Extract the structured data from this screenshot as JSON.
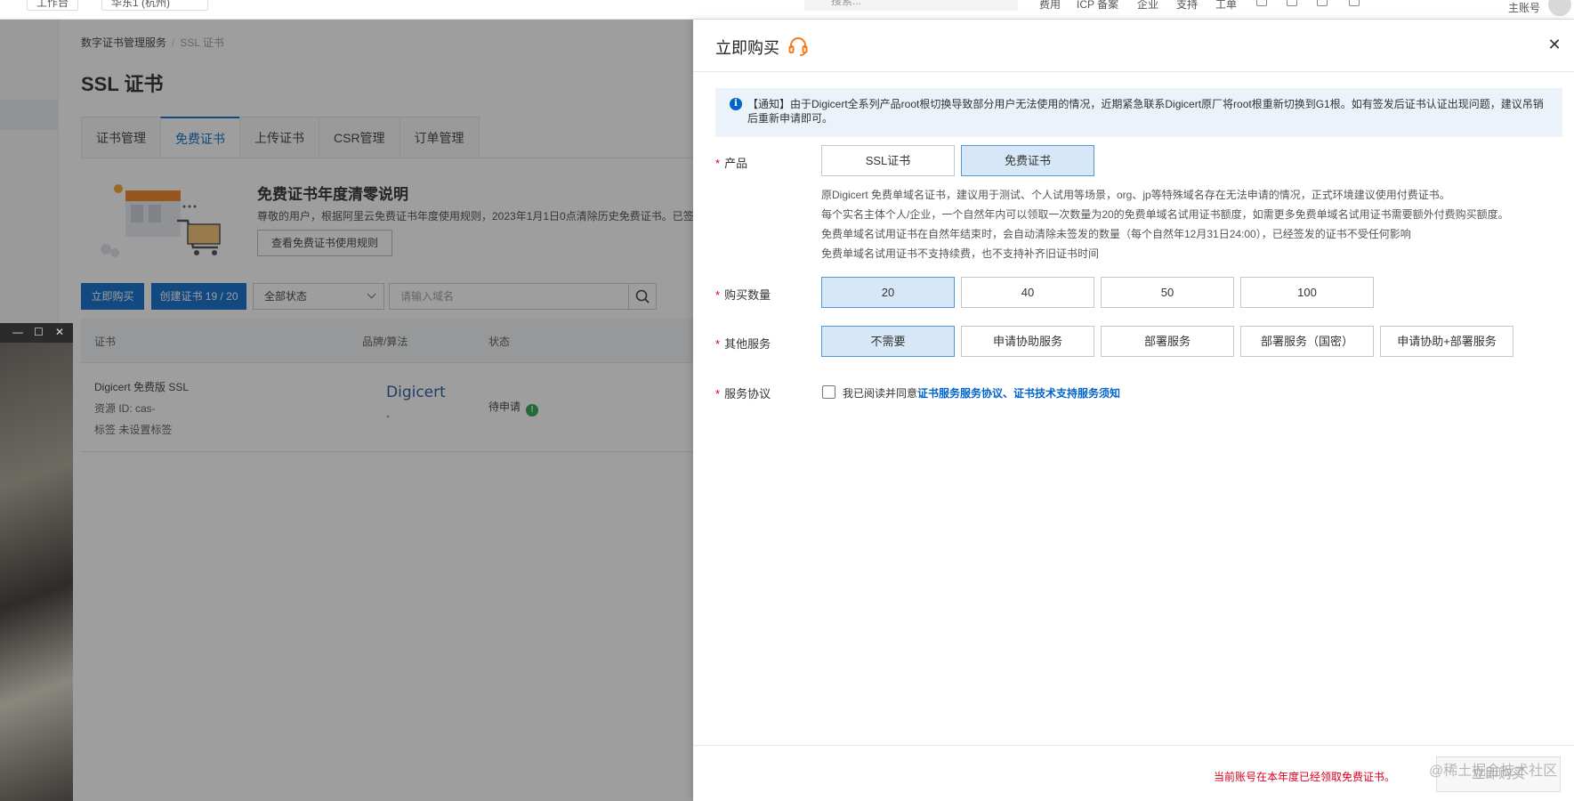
{
  "topbar": {
    "workbench_label": "工作台",
    "org_label": "华东1 (杭州)",
    "search_placeholder": "搜索...",
    "links": [
      "费用",
      "ICP 备案",
      "企业",
      "支持",
      "工单"
    ],
    "account_label": "主账号"
  },
  "breadcrumb": {
    "root": "数字证书管理服务",
    "separator": "/",
    "current": "SSL 证书"
  },
  "page_title": "SSL 证书",
  "tabs": [
    {
      "label": "证书管理"
    },
    {
      "label": "免费证书"
    },
    {
      "label": "上传证书"
    },
    {
      "label": "CSR管理"
    },
    {
      "label": "订单管理"
    }
  ],
  "banner": {
    "title": "免费证书年度清零说明",
    "text": "尊敬的用户，根据阿里云免费证书年度使用规则，2023年1月1日0点清除历史免费证书。已签发",
    "button": "查看免费证书使用规则"
  },
  "toolbar": {
    "buy_label": "立即购买",
    "create_label": "创建证书 19 / 20",
    "status_value": "全部状态",
    "search_placeholder": "请输入域名"
  },
  "table": {
    "headers": {
      "cert": "证书",
      "brand": "品牌/算法",
      "status": "状态"
    },
    "rows": [
      {
        "name": "Digicert 免费版 SSL",
        "resource": "资源 ID: cas-",
        "tag": "标签 未设置标签",
        "brand": "Digicert",
        "brand_sub": "-",
        "status": "待申请"
      }
    ]
  },
  "video_overlay": {
    "minimize": "—",
    "maximize": "☐",
    "close": "✕"
  },
  "drawer": {
    "title": "立即购买",
    "notice": "【通知】由于Digicert全系列产品root根切换导致部分用户无法使用的情况，近期紧急联系Digicert原厂将root根重新切换到G1根。如有签发后证书认证出现问题，建议吊销后重新申请即可。",
    "product": {
      "label": "产品",
      "options": [
        "SSL证书",
        "免费证书"
      ],
      "selected": "免费证书"
    },
    "description": [
      "原Digicert 免费单域名证书，建议用于测试、个人试用等场景，org、jp等特殊域名存在无法申请的情况，正式环境建议使用付费证书。",
      "每个实名主体个人/企业，一个自然年内可以领取一次数量为20的免费单域名试用证书额度，如需更多免费单域名试用证书需要额外付费购买额度。",
      "免费单域名试用证书在自然年结束时，会自动清除未签发的数量（每个自然年12月31日24:00），已经签发的证书不受任何影响",
      "免费单域名试用证书不支持续费，也不支持补齐旧证书时间"
    ],
    "quantity": {
      "label": "购买数量",
      "options": [
        "20",
        "40",
        "50",
        "100"
      ],
      "selected": "20"
    },
    "services": {
      "label": "其他服务",
      "options": [
        "不需要",
        "申请协助服务",
        "部署服务",
        "部署服务（国密）",
        "申请协助+部署服务"
      ],
      "selected": "不需要"
    },
    "agreement": {
      "label": "服务协议",
      "checked": false,
      "prefix": "我已阅读并同意",
      "link1": "证书服务服务协议",
      "sep": "、",
      "link2": "证书技术支持服务须知"
    },
    "footer": {
      "warning": "当前账号在本年度已经领取免费证书。",
      "button": "立即购买"
    }
  },
  "watermark": "@稀土掘金技术社区",
  "colors": {
    "primary": "#0064c8",
    "selected_bg": "#d6e8f7",
    "danger": "#d9001b",
    "success": "#1fa14a"
  }
}
